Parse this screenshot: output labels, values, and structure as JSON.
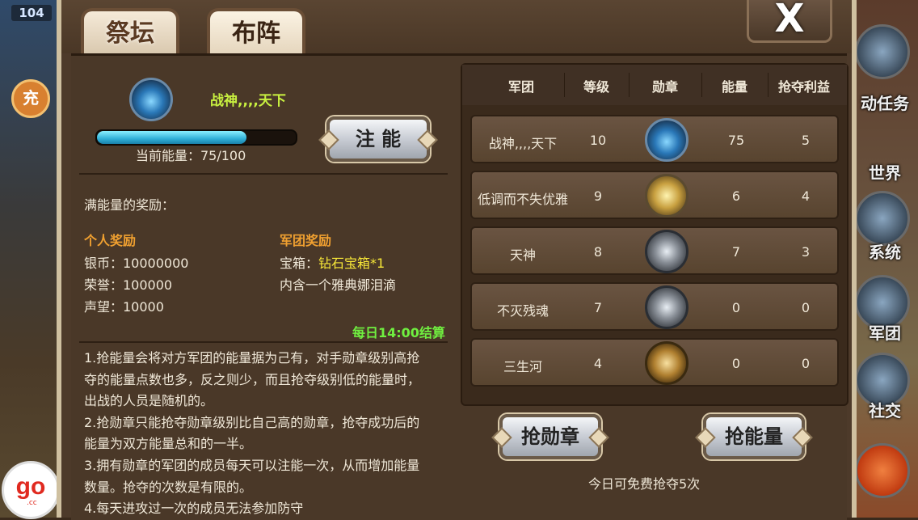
{
  "hud": {
    "level": "104",
    "side_chip": "充",
    "right_menu": [
      "动任务",
      "世界",
      "系统",
      "军团",
      "社交"
    ],
    "logo_text": "go",
    "logo_sub": ".cc"
  },
  "tabs": [
    {
      "label": "祭坛",
      "active": false
    },
    {
      "label": "布阵",
      "active": true
    }
  ],
  "close_label": "X",
  "my_legion": {
    "name": "战神,,,,天下",
    "emblem": "blue-horseshoe-emblem",
    "energy_current": 75,
    "energy_max": 100,
    "energy_fraction": 0.75,
    "energy_text": "当前能量：75/100",
    "inject_button": "注  能"
  },
  "rewards": {
    "heading": "满能量的奖励：",
    "personal_title": "个人奖励",
    "personal": [
      "银币：10000000",
      "荣誉：100000",
      "声望：10000"
    ],
    "legion_title": "军团奖励",
    "legion_box_label": "宝箱：",
    "legion_box_value": "钻石宝箱*1",
    "legion_box_desc": "内含一个雅典娜泪滴",
    "settle_time": "每日14:00结算"
  },
  "rules": [
    "1.抢能量会将对方军团的能量据为己有，对手勋章级别高抢夺的能量点数也多，反之则少，而且抢夺级别低的能量时，出战的人员是随机的。",
    "2.抢勋章只能抢夺勋章级别比自己高的勋章，抢夺成功后的能量为双方能量总和的一半。",
    "3.拥有勋章的军团的成员每天可以注能一次，从而增加能量数量。抢夺的次数是有限的。",
    "4.每天进攻过一次的成员无法参加防守"
  ],
  "table": {
    "headers": [
      "军团",
      "等级",
      "勋章",
      "能量",
      "抢夺利益"
    ],
    "rows": [
      {
        "name": "战神,,,,天下",
        "level": "10",
        "medal": "blue-horseshoe-emblem",
        "energy": "75",
        "profit": "5"
      },
      {
        "name": "低调而不失优雅",
        "level": "9",
        "medal": "gold-emblem",
        "energy": "6",
        "profit": "4"
      },
      {
        "name": "天神",
        "level": "8",
        "medal": "silver-flower-emblem",
        "energy": "7",
        "profit": "3"
      },
      {
        "name": "不灭残魂",
        "level": "7",
        "medal": "silver-flower-emblem",
        "energy": "0",
        "profit": "0"
      },
      {
        "name": "三生河",
        "level": "4",
        "medal": "bronze-star-emblem",
        "energy": "0",
        "profit": "0"
      }
    ]
  },
  "actions": {
    "grab_medal": "抢勋章",
    "grab_energy": "抢能量",
    "free_text": "今日可免费抢夺5次"
  }
}
